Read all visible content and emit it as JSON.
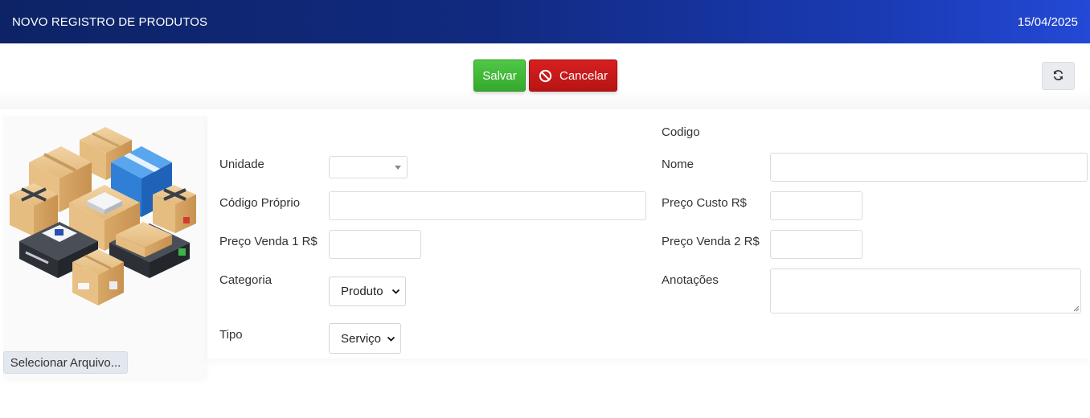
{
  "header": {
    "title": "NOVO REGISTRO DE PRODUTOS",
    "date": "15/04/2025"
  },
  "toolbar": {
    "save_label": "Salvar",
    "cancel_label": "Cancelar",
    "refresh_icon": "refresh-icon",
    "cancel_icon": "ban-icon"
  },
  "image_panel": {
    "image_icon": "boxes-illustration",
    "file_button_label": "Selecionar Arquivo..."
  },
  "form": {
    "left": {
      "unidade": {
        "label": "Unidade",
        "value": ""
      },
      "codigo_proprio": {
        "label": "Código Próprio",
        "value": ""
      },
      "preco_venda_1": {
        "label": "Preço Venda 1 R$",
        "value": ""
      },
      "categoria": {
        "label": "Categoria",
        "value": "Produto"
      },
      "tipo": {
        "label": "Tipo",
        "value": "Serviço"
      }
    },
    "right": {
      "codigo": {
        "label": "Codigo",
        "value": ""
      },
      "nome": {
        "label": "Nome",
        "value": ""
      },
      "preco_custo": {
        "label": "Preço Custo R$",
        "value": ""
      },
      "preco_venda_2": {
        "label": "Preço Venda 2 R$",
        "value": ""
      },
      "anotacoes": {
        "label": "Anotações",
        "value": ""
      }
    }
  },
  "colors": {
    "header_start": "#0d2366",
    "header_end": "#2349d6",
    "save": "#3cb534",
    "cancel": "#c41919"
  }
}
